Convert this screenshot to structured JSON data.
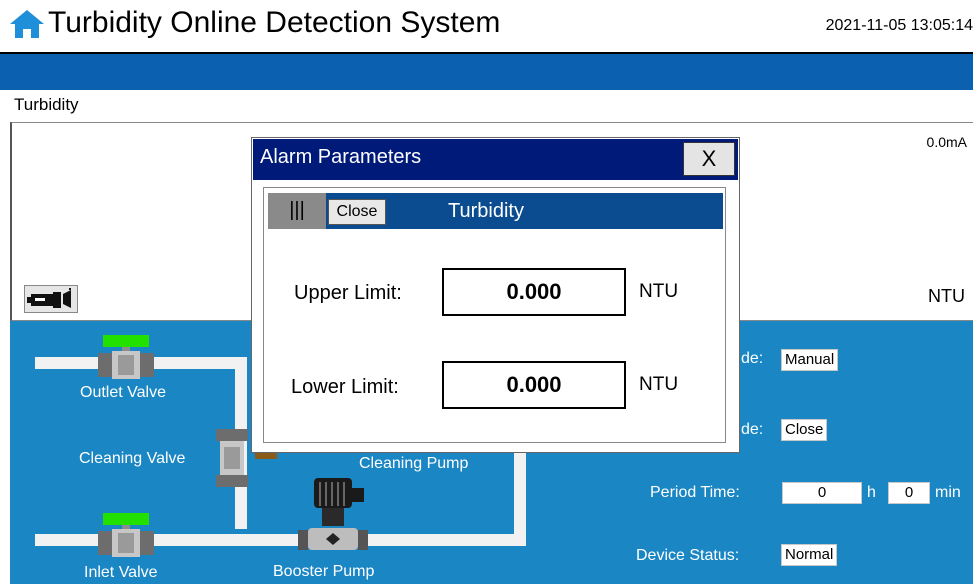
{
  "header": {
    "title": "Turbidity Online Detection System",
    "datetime": "2021-11-05 13:05:14",
    "home_icon": "home-icon"
  },
  "panel": {
    "section_label": "Turbidity",
    "current": "0.0mA",
    "unit": "NTU",
    "pump_icon": "pump-icon"
  },
  "process": {
    "outlet_valve": "Outlet Valve",
    "cleaning_valve": "Cleaning Valve",
    "cleaning_pump": "Cleaning Pump",
    "inlet_valve": "Inlet Valve",
    "booster_pump": "Booster Pump",
    "mode_label_suffix": "de:",
    "mode_value": "Manual",
    "valve_mode_label_suffix": "de:",
    "valve_mode_value": "Close",
    "period_label": "Period Time:",
    "period_h_value": "0",
    "period_h_unit": "h",
    "period_min_value": "0",
    "period_min_unit": "min",
    "device_status_label": "Device Status:",
    "device_status_value": "Normal",
    "colors": {
      "pipe": "#f2f2f2",
      "valve_open": "#22e000",
      "background": "#1a86c4"
    }
  },
  "dialog": {
    "title": "Alarm Parameters",
    "close_label": "X",
    "subbar": {
      "grip": "|||",
      "close_label": "Close",
      "title": "Turbidity"
    },
    "upper_label": "Upper Limit:",
    "upper_value": "0.000",
    "upper_unit": "NTU",
    "lower_label": "Lower Limit:",
    "lower_value": "0.000",
    "lower_unit": "NTU"
  }
}
